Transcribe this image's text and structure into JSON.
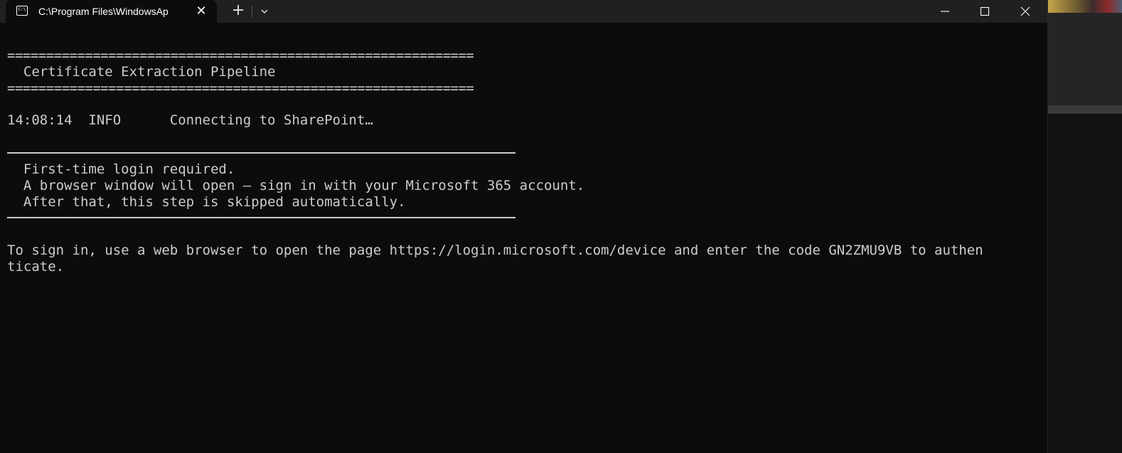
{
  "window": {
    "tab_title": "C:\\Program Files\\WindowsAp",
    "tab_icon": "terminal-icon",
    "tab_icon_glyph": "C:\\",
    "new_tab_symbol": "+",
    "close_tab_symbol": "✕"
  },
  "console": {
    "lines": {
      "rule_top": "============================================================",
      "title": "  Certificate Extraction Pipeline",
      "rule_bottom": "============================================================",
      "log_entry": "14:08:14  INFO      Connecting to SharePoint…",
      "notice_1": "  First-time login required.",
      "notice_2": "  A browser window will open — sign in with your Microsoft 365 account.",
      "notice_3": "  After that, this step is skipped automatically.",
      "device_code_1": "To sign in, use a web browser to open the page https://login.microsoft.com/device and enter the code GN2ZMU9VB to authen",
      "device_code_2": "ticate."
    }
  },
  "colors": {
    "background": "#0c0c0c",
    "titlebar": "#202020",
    "text": "#cccccc"
  }
}
